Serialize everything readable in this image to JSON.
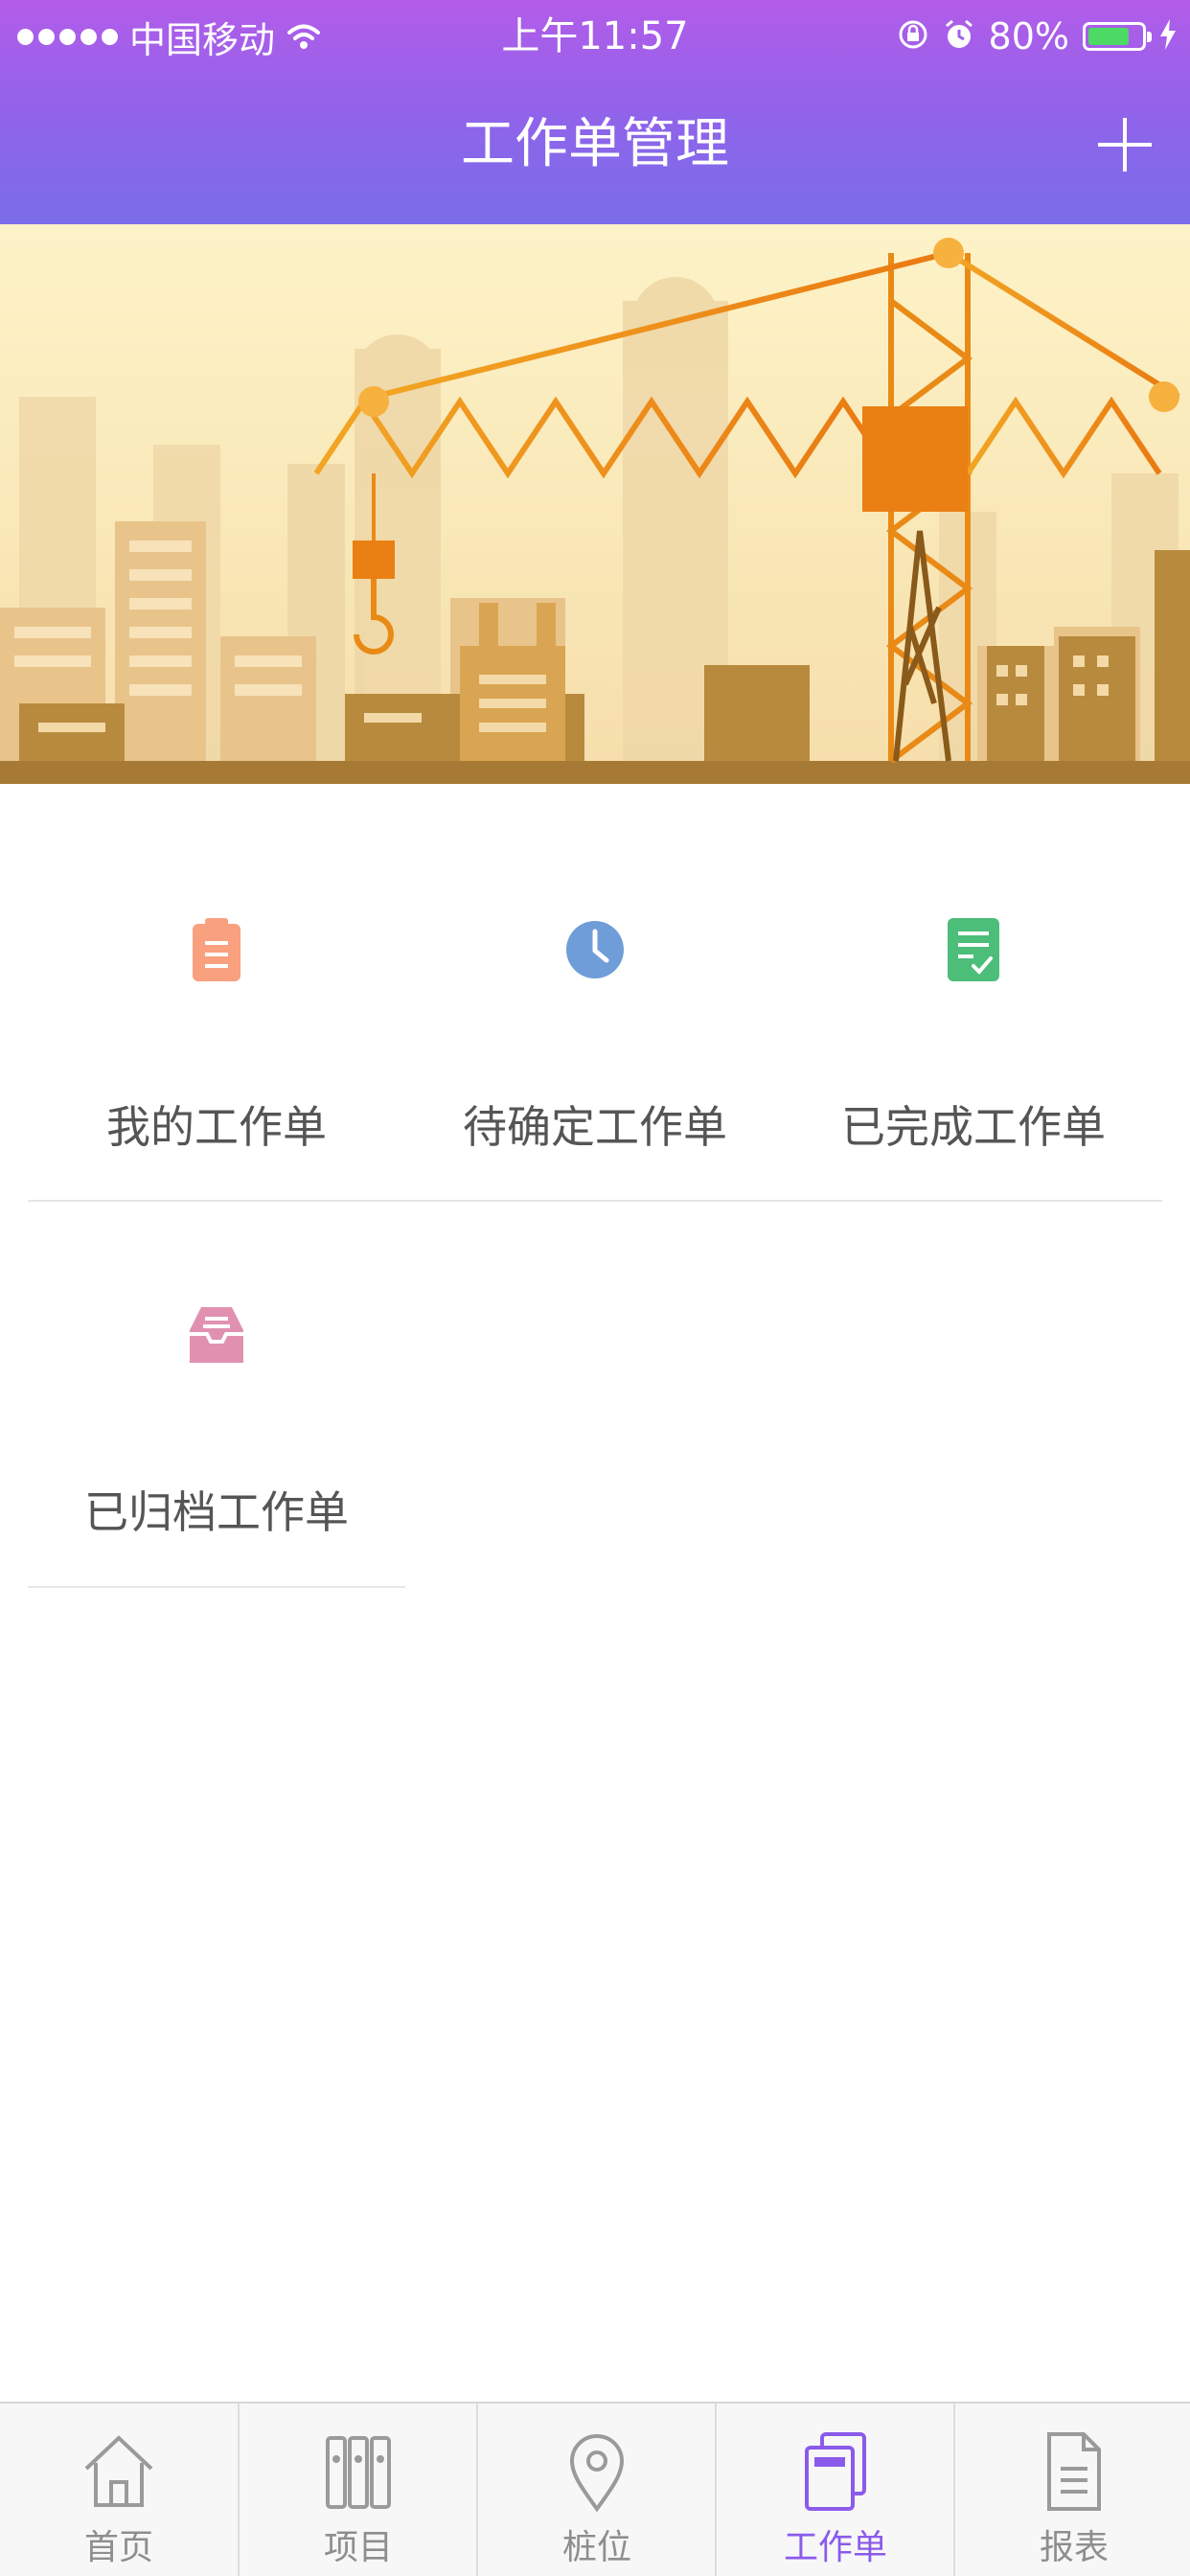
{
  "status_bar": {
    "carrier": "中国移动",
    "time": "上午11:57",
    "battery_percent": "80%",
    "battery_level": 0.8
  },
  "nav": {
    "title": "工作单管理",
    "add_icon": "plus-icon"
  },
  "banner": {
    "description_icon": "construction-crane-illustration"
  },
  "grid": [
    {
      "label": "我的工作单",
      "icon": "clipboard-icon",
      "color": "#f9a07f"
    },
    {
      "label": "待确定工作单",
      "icon": "clock-icon",
      "color": "#6f9dd8"
    },
    {
      "label": "已完成工作单",
      "icon": "checklist-icon",
      "color": "#4dbd7a"
    },
    {
      "label": "已归档工作单",
      "icon": "inbox-archive-icon",
      "color": "#e191b0"
    }
  ],
  "tabs": [
    {
      "label": "首页",
      "icon": "home-icon",
      "active": false
    },
    {
      "label": "项目",
      "icon": "binders-icon",
      "active": false
    },
    {
      "label": "桩位",
      "icon": "location-pin-icon",
      "active": false
    },
    {
      "label": "工作单",
      "icon": "workorder-stack-icon",
      "active": true
    },
    {
      "label": "报表",
      "icon": "report-document-icon",
      "active": false
    }
  ],
  "colors": {
    "header_gradient_top": "#b25ce9",
    "header_gradient_bottom": "#7a6de9",
    "active_tab": "#8a5bea",
    "inactive_tab": "#8e8e8e"
  }
}
